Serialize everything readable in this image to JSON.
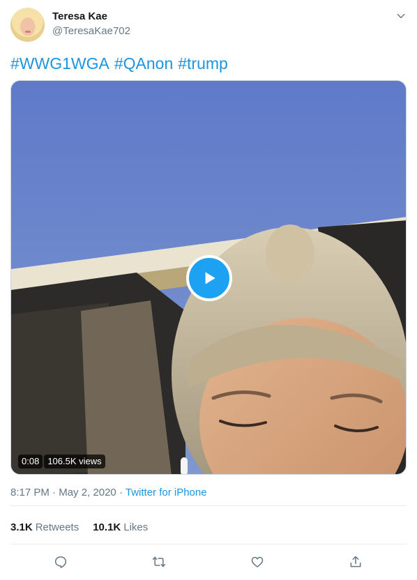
{
  "author": {
    "display_name": "Teresa Kae",
    "handle": "@TeresaKae702",
    "avatar_icon": "profile-photo"
  },
  "tweet": {
    "hashtags": [
      "#WWG1WGA",
      "#QAnon",
      "#trump"
    ]
  },
  "video": {
    "duration": "0:08",
    "views": "106.5K views"
  },
  "meta": {
    "time": "8:17 PM",
    "separator": "·",
    "date": "May 2, 2020",
    "source": "Twitter for iPhone"
  },
  "stats": {
    "retweets_count": "3.1K",
    "retweets_label": "Retweets",
    "likes_count": "10.1K",
    "likes_label": "Likes"
  },
  "actions": [
    "reply-icon",
    "retweet-icon",
    "like-icon",
    "share-icon"
  ],
  "colors": {
    "link": "#1b95e0",
    "play_button": "#1da1f2",
    "secondary_text": "#657786",
    "primary_text": "#14171a"
  }
}
